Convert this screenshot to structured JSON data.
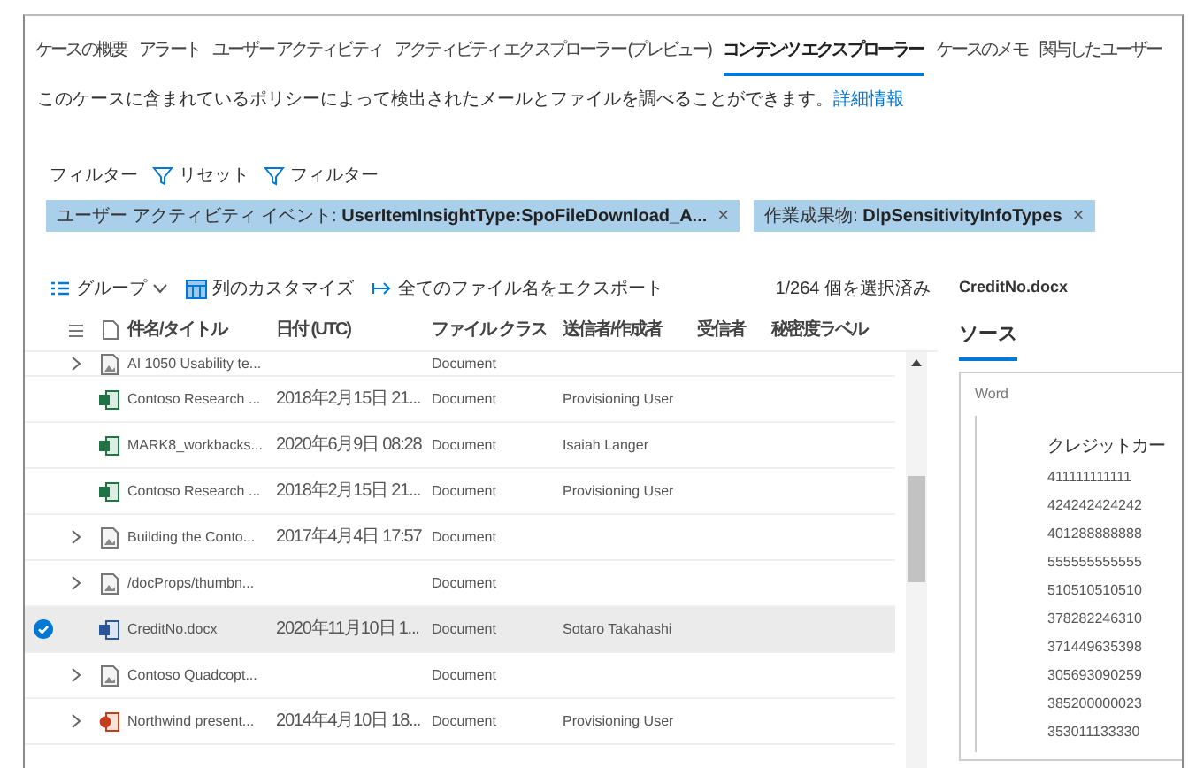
{
  "tabs": [
    {
      "label": "ケースの概要",
      "selected": false
    },
    {
      "label": "アラート",
      "selected": false
    },
    {
      "label": "ユーザー アクティビティ",
      "selected": false
    },
    {
      "label": "アクティビティ エクスプローラー (プレビュー)",
      "selected": false
    },
    {
      "label": "コンテンツ エクスプローラー",
      "selected": true
    },
    {
      "label": "ケースのメモ",
      "selected": false
    },
    {
      "label": "関与したユーザー",
      "selected": false
    }
  ],
  "description": {
    "text": "このケースに含まれているポリシーによって検出されたメールとファイルを調べることができます。",
    "link": "詳細情報"
  },
  "filter_bar": {
    "label": "フィルター",
    "reset": "リセット",
    "filter": "フィルター"
  },
  "chips": [
    {
      "text": "ユーザー アクティビティ イベント: **UserItemInsightType:SpoFileDownload_A...**",
      "close": "×"
    },
    {
      "text": "作業成果物: **DlpSensitivityInfoTypes**",
      "close": "×"
    }
  ],
  "toolbar": {
    "group": "グループ",
    "customize": "列のカスタマイズ",
    "export": "全てのファイル名をエクスポート",
    "selection_count": "1/264 個を選択済み"
  },
  "table": {
    "columns": [
      "件名/タイトル",
      "日付 (UTC)",
      "ファイル クラス",
      "送信者/作成者",
      "受信者",
      "秘密度ラベル"
    ],
    "rows": [
      {
        "kind": "generic",
        "expandable": true,
        "selected": false,
        "partial": true,
        "name": "AI 1050 Usability te...",
        "date": "",
        "class": "Document",
        "sender": ""
      },
      {
        "kind": "excel",
        "expandable": false,
        "selected": false,
        "name": "Contoso Research ...",
        "date": "2018年2月15日 21...",
        "class": "Document",
        "sender": "Provisioning User"
      },
      {
        "kind": "excel",
        "expandable": false,
        "selected": false,
        "name": "MARK8_workbacks...",
        "date": "2020年6月9日 08:28",
        "class": "Document",
        "sender": "Isaiah Langer"
      },
      {
        "kind": "excel",
        "expandable": false,
        "selected": false,
        "name": "Contoso Research ...",
        "date": "2018年2月15日 21...",
        "class": "Document",
        "sender": "Provisioning User"
      },
      {
        "kind": "generic",
        "expandable": true,
        "selected": false,
        "name": "Building the Conto...",
        "date": "2017年4月4日 17:57",
        "class": "Document",
        "sender": ""
      },
      {
        "kind": "generic",
        "expandable": true,
        "selected": false,
        "name": "/docProps/thumbn...",
        "date": "",
        "class": "Document",
        "sender": ""
      },
      {
        "kind": "word",
        "expandable": false,
        "selected": true,
        "name": "CreditNo.docx",
        "date": "2020年11月10日 1...",
        "class": "Document",
        "sender": "Sotaro Takahashi"
      },
      {
        "kind": "generic",
        "expandable": true,
        "selected": false,
        "name": "Contoso Quadcopt...",
        "date": "",
        "class": "Document",
        "sender": ""
      },
      {
        "kind": "powerpoint",
        "expandable": true,
        "selected": false,
        "name": "Northwind present...",
        "date": "2014年4月10日 18...",
        "class": "Document",
        "sender": "Provisioning User"
      }
    ]
  },
  "detail": {
    "title": "CreditNo.docx",
    "tabs": [
      {
        "label": "ソース",
        "selected": true
      }
    ],
    "preview_label": "Word",
    "heading": "クレジットカー",
    "lines": [
      "411111111111",
      "424242424242",
      "401288888888",
      "555555555555",
      "510510510510",
      "378282246310",
      "371449635398",
      "305693090259",
      "385200000023",
      "353011133330"
    ]
  }
}
